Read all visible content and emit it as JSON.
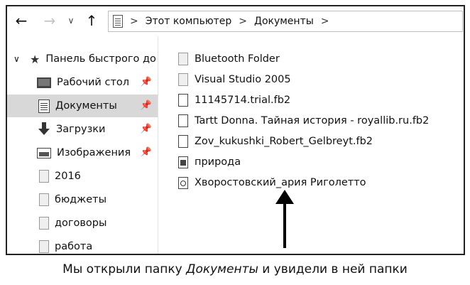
{
  "toolbar": {
    "back_icon": "←",
    "forward_icon": "→",
    "dropdown_icon": "∨",
    "up_icon": "↑",
    "address": {
      "icon": "document-icon",
      "separator": ">",
      "crumb1": "Этот компьютер",
      "crumb2": "Документы"
    }
  },
  "sidebar": {
    "chevron": "∨",
    "quick_access_label": "Панель быстрого доступа",
    "items": [
      {
        "label": "Рабочий стол",
        "icon": "desktop-icon",
        "pinned": true
      },
      {
        "label": "Документы",
        "icon": "documents-icon",
        "pinned": true,
        "selected": true
      },
      {
        "label": "Загрузки",
        "icon": "downloads-icon",
        "pinned": true
      },
      {
        "label": "Изображения",
        "icon": "pictures-icon",
        "pinned": true
      },
      {
        "label": "2016",
        "icon": "folder-icon"
      },
      {
        "label": "бюджеты",
        "icon": "folder-icon"
      },
      {
        "label": "договоры",
        "icon": "folder-icon"
      },
      {
        "label": "работа",
        "icon": "folder-icon"
      }
    ],
    "pin_glyph": "📌"
  },
  "files": [
    {
      "name": "Bluetooth Folder",
      "type": "folder"
    },
    {
      "name": "Visual Studio 2005",
      "type": "folder"
    },
    {
      "name": "11145714.trial.fb2",
      "type": "document"
    },
    {
      "name": "Tartt Donna. Тайная история - royallib.ru.fb2",
      "type": "document"
    },
    {
      "name": "Zov_kukushki_Robert_Gelbreyt.fb2",
      "type": "document"
    },
    {
      "name": "природа",
      "type": "image"
    },
    {
      "name": "Хворостовский_ария Риголетто",
      "type": "audio"
    }
  ],
  "caption": {
    "before": "Мы открыли папку ",
    "emph": "Документы",
    "after": " и увидели в ней папки"
  }
}
